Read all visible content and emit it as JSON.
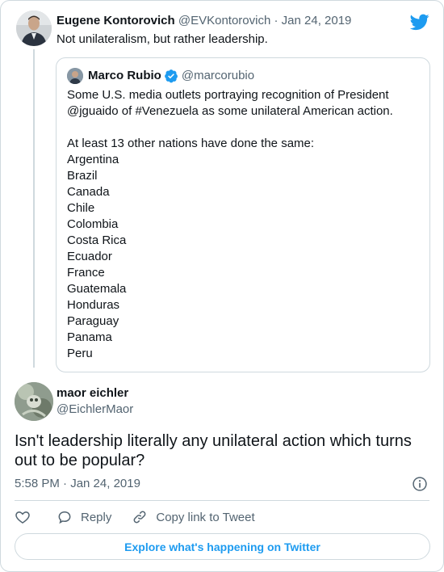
{
  "parent": {
    "name": "Eugene Kontorovich",
    "handle": "@EVKontorovich",
    "separator": "·",
    "date": "Jan 24, 2019",
    "text": "Not unilateralism, but rather leadership."
  },
  "quote": {
    "name": "Marco Rubio",
    "handle": "@marcorubio",
    "line1": "Some U.S. media outlets portraying recognition of President",
    "line2": "@jguaido of #Venezuela as some unilateral American action.",
    "line3": "At least 13 other nations have done the same:",
    "countries": [
      "Argentina",
      "Brazil",
      "Canada",
      "Chile",
      "Colombia",
      "Costa Rica",
      "Ecuador",
      "France",
      "Guatemala",
      "Honduras",
      "Paraguay",
      "Panama",
      "Peru"
    ]
  },
  "reply": {
    "name": "maor eichler",
    "handle": "@EichlerMaor",
    "text": "Isn't leadership literally any unilateral action which turns out to be popular?",
    "timestamp": "5:58 PM · Jan 24, 2019"
  },
  "actions": {
    "like_icon": "heart-icon",
    "reply_label": "Reply",
    "reply_icon": "speech-bubble-icon",
    "copy_label": "Copy link to Tweet",
    "copy_icon": "link-icon"
  },
  "explore_label": "Explore what's happening on Twitter",
  "colors": {
    "brand_blue": "#1d9bf0",
    "text": "#0f1419",
    "muted": "#536471",
    "border": "#cfd9de"
  }
}
